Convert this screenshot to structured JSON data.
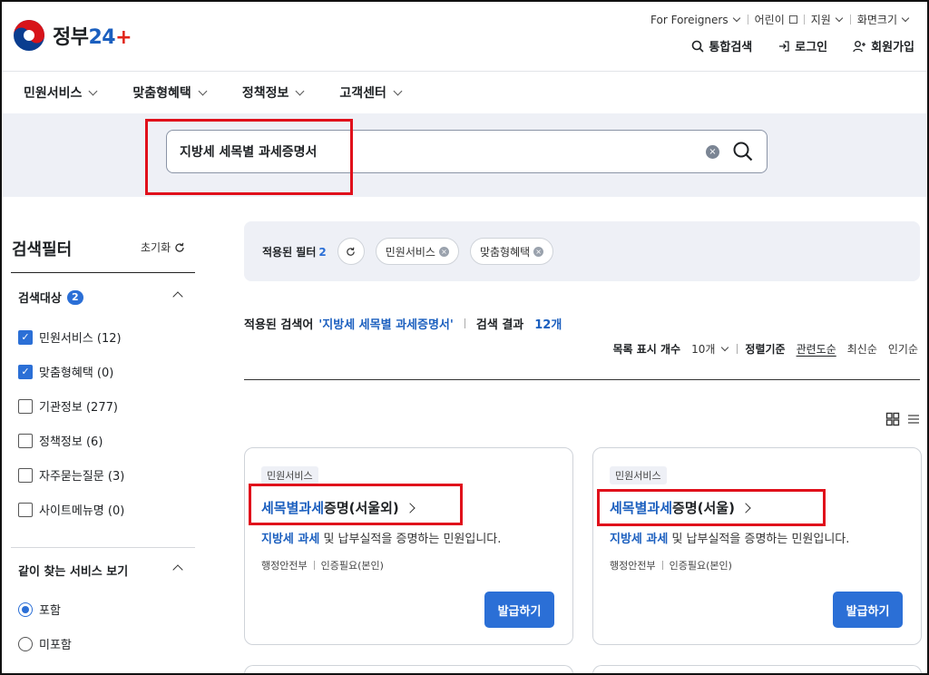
{
  "header": {
    "logo_text": "정부",
    "logo_number": "24",
    "logo_plus": "+",
    "utility": [
      "For Foreigners",
      "어린이",
      "지원",
      "화면크기"
    ],
    "actions": [
      "통합검색",
      "로그인",
      "회원가입"
    ]
  },
  "gnb": [
    "민원서비스",
    "맞춤형혜택",
    "정책정보",
    "고객센터"
  ],
  "search": {
    "value": "지방세 세목별 과세증명서",
    "clear_label": "×"
  },
  "filter": {
    "title": "검색필터",
    "reset_label": "초기화",
    "group_target": {
      "title": "검색대상",
      "count": "2",
      "options": [
        {
          "label": "민원서비스 (12)",
          "checked": true
        },
        {
          "label": "맞춤형혜택 (0)",
          "checked": true
        },
        {
          "label": "기관정보 (277)",
          "checked": false
        },
        {
          "label": "정책정보 (6)",
          "checked": false
        },
        {
          "label": "자주묻는질문 (3)",
          "checked": false
        },
        {
          "label": "사이트메뉴명 (0)",
          "checked": false
        }
      ]
    },
    "group_related": {
      "title": "같이 찾는 서비스 보기",
      "options": [
        {
          "label": "포함",
          "selected": true
        },
        {
          "label": "미포함",
          "selected": false
        }
      ]
    }
  },
  "applied": {
    "label": "적용된 필터",
    "count": "2",
    "chips": [
      "민원서비스",
      "맞춤형혜택"
    ]
  },
  "results": {
    "query_label": "적용된 검색어",
    "query": "'지방세 세목별 과세증명서'",
    "result_label": "검색 결과",
    "result_count": "12개"
  },
  "sort": {
    "page_size_label": "목록 표시 개수",
    "page_size_value": "10개",
    "sort_label": "정렬기준",
    "options": [
      "관련도순",
      "최신순",
      "인기순"
    ],
    "selected": "관련도순"
  },
  "cards": [
    {
      "tag": "민원서비스",
      "title_highlight": "세목별과세",
      "title_rest": "증명(서울외)",
      "desc_highlight": "지방세 과세",
      "desc_rest": " 및 납부실적을 증명하는 민원입니다.",
      "agency": "행정안전부",
      "auth": "인증필요(본인)",
      "button": "발급하기"
    },
    {
      "tag": "민원서비스",
      "title_highlight": "세목별과세",
      "title_rest": "증명(서울)",
      "desc_highlight": "지방세 과세",
      "desc_rest": " 및 납부실적을 증명하는 민원입니다.",
      "agency": "행정안전부",
      "auth": "인증필요(본인)",
      "button": "발급하기"
    }
  ],
  "colors": {
    "accent": "#2b6fd6",
    "highlight": "#1b5fbf",
    "band": "#eef0f6",
    "annotation": "#e0101b"
  }
}
